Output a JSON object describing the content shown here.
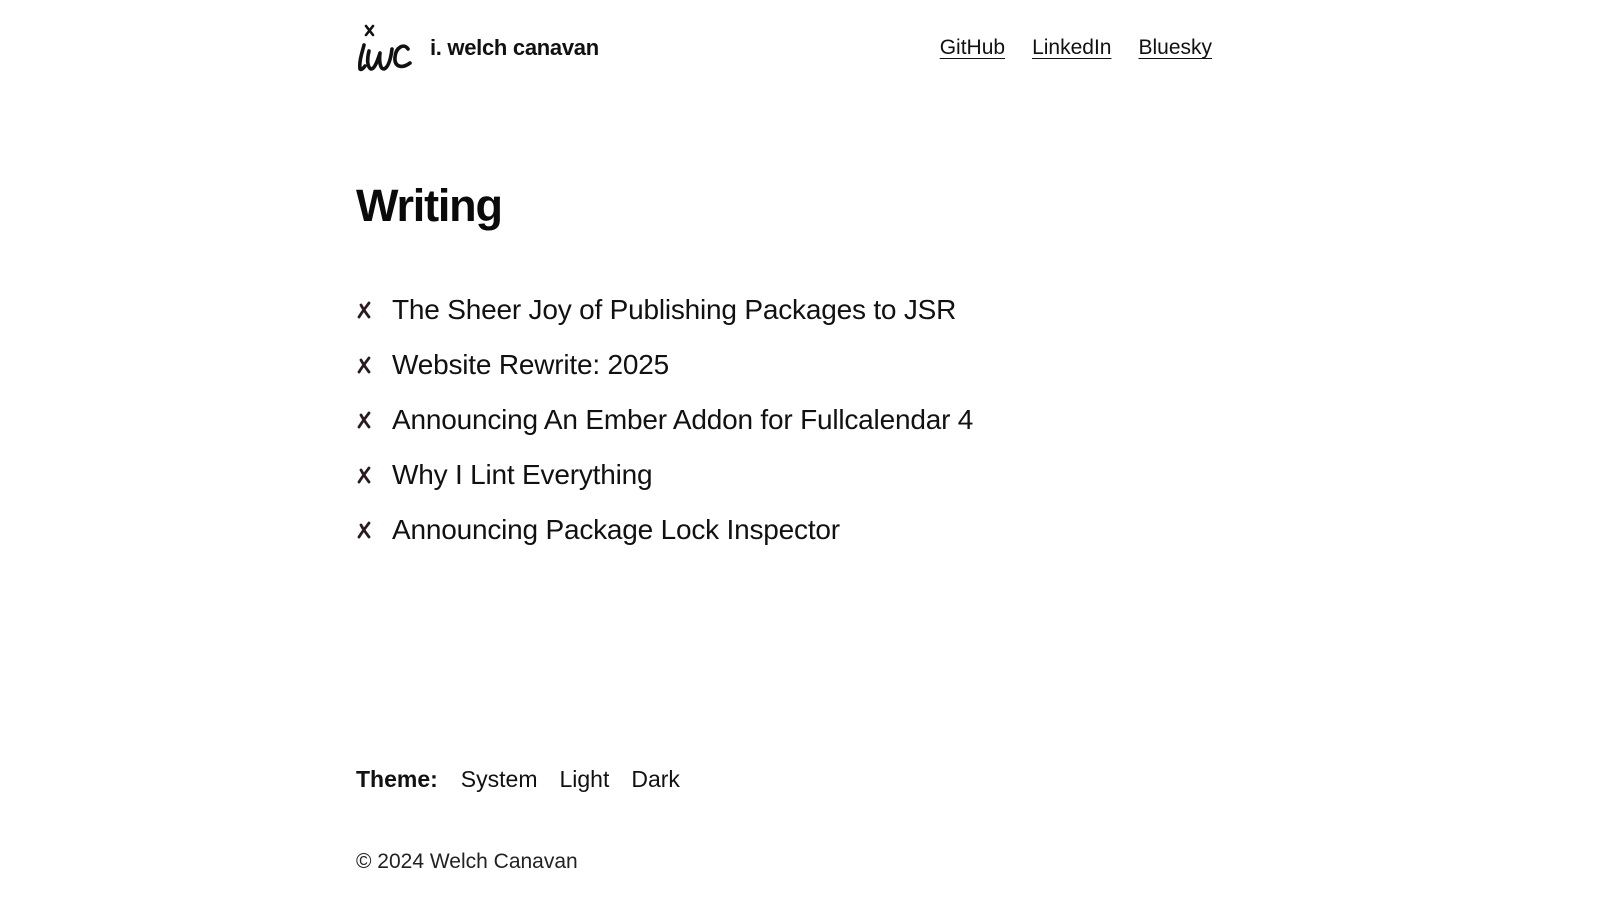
{
  "header": {
    "site_name": "i. welch canavan",
    "logo_icon": "iwc-monogram-logo",
    "nav": [
      {
        "label": "GitHub"
      },
      {
        "label": "LinkedIn"
      },
      {
        "label": "Bluesky"
      }
    ]
  },
  "main": {
    "title": "Writing",
    "bullet_icon": "x-mark-icon",
    "posts": [
      {
        "title": "The Sheer Joy of Publishing Packages to JSR"
      },
      {
        "title": "Website Rewrite: 2025"
      },
      {
        "title": "Announcing An Ember Addon for Fullcalendar 4"
      },
      {
        "title": "Why I Lint Everything"
      },
      {
        "title": "Announcing Package Lock Inspector"
      }
    ]
  },
  "theme": {
    "label": "Theme:",
    "options": [
      "System",
      "Light",
      "Dark"
    ]
  },
  "footer": {
    "copyright": "© 2024 Welch Canavan"
  },
  "colors": {
    "text": "#111111",
    "background": "#ffffff",
    "bullet": "#2a1b22"
  }
}
